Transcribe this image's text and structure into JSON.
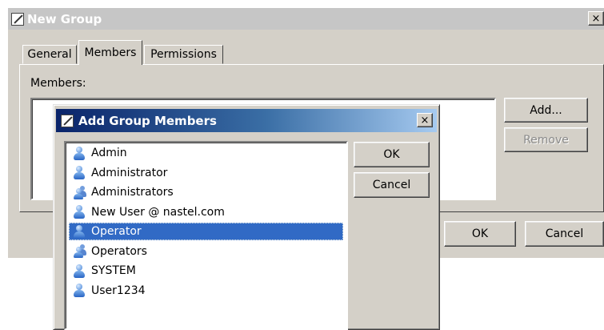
{
  "new_group_dialog": {
    "title": "New Group",
    "close_glyph": "×",
    "tabs": [
      {
        "label": "General"
      },
      {
        "label": "Members"
      },
      {
        "label": "Permissions"
      }
    ],
    "members_label": "Members:",
    "add_button": "Add...",
    "remove_button": "Remove",
    "ok_button": "OK",
    "cancel_button": "Cancel"
  },
  "add_members_dialog": {
    "title": "Add Group Members",
    "close_glyph": "×",
    "ok_button": "OK",
    "cancel_button": "Cancel",
    "items": [
      {
        "label": "Admin",
        "icon": "user-icon",
        "selected": false
      },
      {
        "label": "Administrator",
        "icon": "user-icon",
        "selected": false
      },
      {
        "label": "Administrators",
        "icon": "group-icon",
        "selected": false
      },
      {
        "label": "New User @ nastel.com",
        "icon": "user-icon",
        "selected": false
      },
      {
        "label": "Operator",
        "icon": "user-icon",
        "selected": true
      },
      {
        "label": "Operators",
        "icon": "group-icon",
        "selected": false
      },
      {
        "label": "SYSTEM",
        "icon": "user-icon",
        "selected": false
      },
      {
        "label": "User1234",
        "icon": "user-icon",
        "selected": false
      }
    ]
  },
  "colors": {
    "dialog_face": "#d4d0c8",
    "active_title": "#0a246a",
    "inactive_title": "#c6c6c6",
    "selection": "#316ac5"
  }
}
